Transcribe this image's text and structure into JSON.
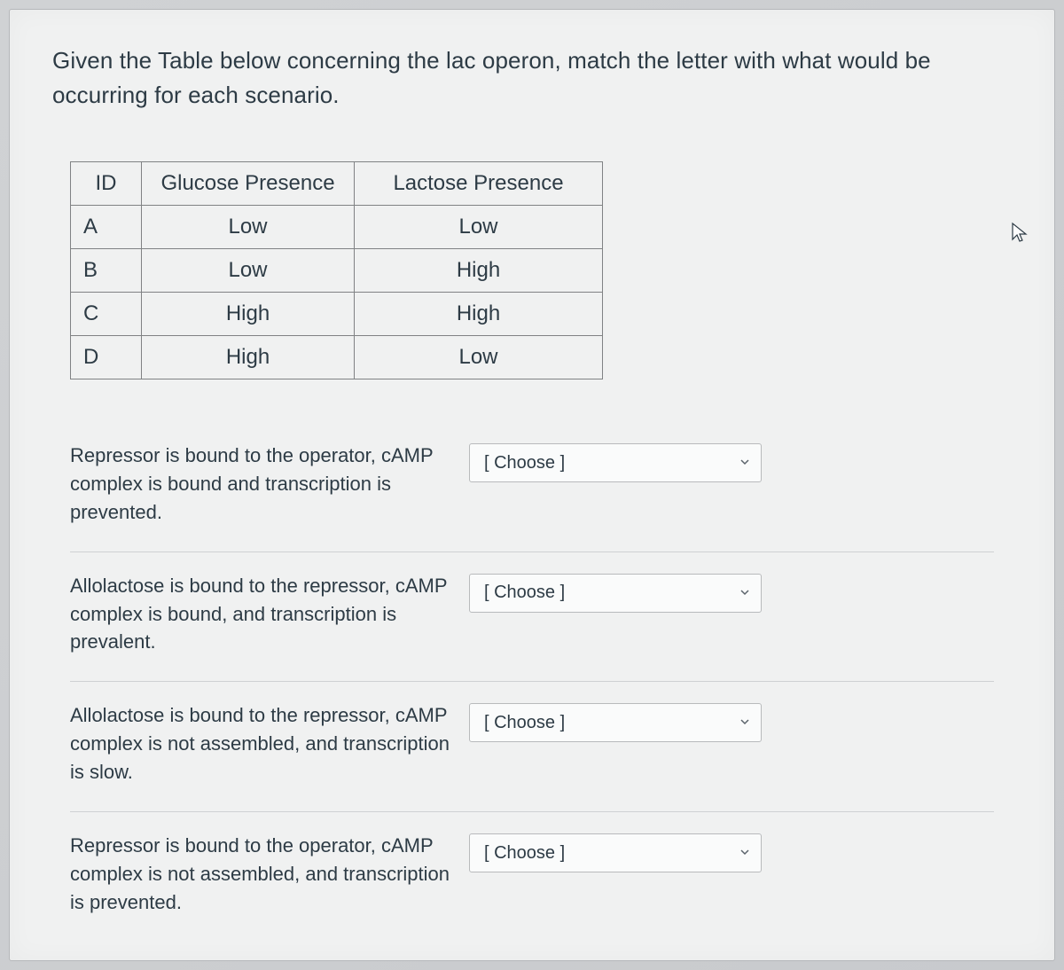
{
  "prompt": "Given the Table below concerning the lac operon, match the letter with what would be occurring for each scenario.",
  "table": {
    "headers": {
      "id": "ID",
      "glucose": "Glucose Presence",
      "lactose": "Lactose Presence"
    },
    "rows": [
      {
        "id": "A",
        "glucose": "Low",
        "lactose": "Low"
      },
      {
        "id": "B",
        "glucose": "Low",
        "lactose": "High"
      },
      {
        "id": "C",
        "glucose": "High",
        "lactose": "High"
      },
      {
        "id": "D",
        "glucose": "High",
        "lactose": "Low"
      }
    ]
  },
  "choose_placeholder": "[ Choose ]",
  "statements": [
    "Repressor is bound to the operator, cAMP complex is bound and transcription is prevented.",
    "Allolactose is bound to the repressor, cAMP complex is bound, and transcription is prevalent.",
    "Allolactose is bound to the repressor, cAMP complex is not assembled, and transcription is slow.",
    "Repressor is bound to the operator, cAMP complex is not assembled, and transcription is prevented."
  ]
}
